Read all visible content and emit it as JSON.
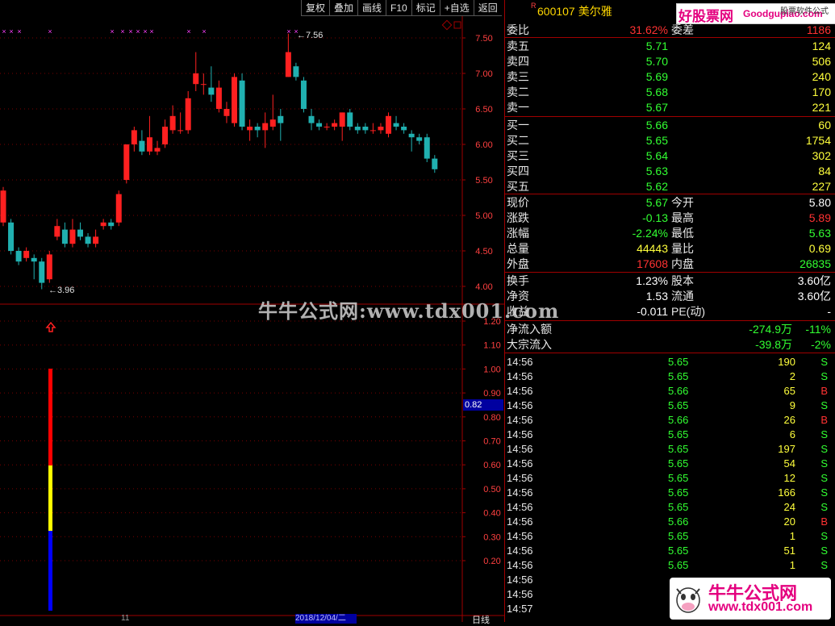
{
  "toolbar": {
    "items": [
      "复权",
      "叠加",
      "画线",
      "F10",
      "标记",
      "+自选",
      "返回"
    ]
  },
  "stock": {
    "flag": "R",
    "code": "600107",
    "name": "美尔雅"
  },
  "logo": {
    "text1": "好股票网",
    "text2": "Goodgupiao.com",
    "text3": "股票软件公式"
  },
  "quote": {
    "weibi_label": "委比",
    "weibi_value": "31.62%",
    "weicha_label": "委差",
    "weicha_value": "1186",
    "sell": [
      {
        "label": "卖五",
        "price": "5.71",
        "vol": "124"
      },
      {
        "label": "卖四",
        "price": "5.70",
        "vol": "506"
      },
      {
        "label": "卖三",
        "price": "5.69",
        "vol": "240"
      },
      {
        "label": "卖二",
        "price": "5.68",
        "vol": "170"
      },
      {
        "label": "卖一",
        "price": "5.67",
        "vol": "221"
      }
    ],
    "buy": [
      {
        "label": "买一",
        "price": "5.66",
        "vol": "60"
      },
      {
        "label": "买二",
        "price": "5.65",
        "vol": "1754"
      },
      {
        "label": "买三",
        "price": "5.64",
        "vol": "302"
      },
      {
        "label": "买四",
        "price": "5.63",
        "vol": "84"
      },
      {
        "label": "买五",
        "price": "5.62",
        "vol": "227"
      }
    ],
    "stats": [
      {
        "l1": "现价",
        "v1": "5.67",
        "l2": "今开",
        "v2": "5.80"
      },
      {
        "l1": "涨跌",
        "v1": "-0.13",
        "l2": "最高",
        "v2": "5.89"
      },
      {
        "l1": "涨幅",
        "v1": "-2.24%",
        "l2": "最低",
        "v2": "5.63"
      },
      {
        "l1": "总量",
        "v1": "44443",
        "l2": "量比",
        "v2": "0.69"
      },
      {
        "l1": "外盘",
        "v1": "17608",
        "l2": "内盘",
        "v2": "26835"
      }
    ],
    "stats2": [
      {
        "l1": "换手",
        "v1": "1.23%",
        "l2": "股本",
        "v2": "3.60亿"
      },
      {
        "l1": "净资",
        "v1": "1.53",
        "l2": "流通",
        "v2": "3.60亿"
      },
      {
        "l1": "收益",
        "v1": "-0.011",
        "l2": "PE(动)",
        "v2": "-"
      }
    ],
    "flow": [
      {
        "l": "净流入额",
        "v": "-274.9万",
        "p": "-11%"
      },
      {
        "l": "大宗流入",
        "v": "-39.8万",
        "p": "-2%"
      }
    ]
  },
  "ticks": [
    {
      "t": "14:56",
      "p": "5.65",
      "v": "190",
      "bs": "S"
    },
    {
      "t": "14:56",
      "p": "5.65",
      "v": "2",
      "bs": "S"
    },
    {
      "t": "14:56",
      "p": "5.66",
      "v": "65",
      "bs": "B"
    },
    {
      "t": "14:56",
      "p": "5.65",
      "v": "9",
      "bs": "S"
    },
    {
      "t": "14:56",
      "p": "5.66",
      "v": "26",
      "bs": "B"
    },
    {
      "t": "14:56",
      "p": "5.65",
      "v": "6",
      "bs": "S"
    },
    {
      "t": "14:56",
      "p": "5.65",
      "v": "197",
      "bs": "S"
    },
    {
      "t": "14:56",
      "p": "5.65",
      "v": "54",
      "bs": "S"
    },
    {
      "t": "14:56",
      "p": "5.65",
      "v": "12",
      "bs": "S"
    },
    {
      "t": "14:56",
      "p": "5.65",
      "v": "166",
      "bs": "S"
    },
    {
      "t": "14:56",
      "p": "5.65",
      "v": "24",
      "bs": "S"
    },
    {
      "t": "14:56",
      "p": "5.66",
      "v": "20",
      "bs": "B"
    },
    {
      "t": "14:56",
      "p": "5.65",
      "v": "1",
      "bs": "S"
    },
    {
      "t": "14:56",
      "p": "5.65",
      "v": "51",
      "bs": "S"
    },
    {
      "t": "14:56",
      "p": "5.65",
      "v": "1",
      "bs": "S"
    },
    {
      "t": "14:56",
      "p": "",
      "v": "",
      "bs": ""
    },
    {
      "t": "14:56",
      "p": "",
      "v": "",
      "bs": ""
    },
    {
      "t": "14:57",
      "p": "",
      "v": "",
      "bs": ""
    }
  ],
  "watermark": {
    "center": "牛牛公式网:www.tdx001.com",
    "corner1": "牛牛公式网",
    "corner2": "www.tdx001.com"
  },
  "chart": {
    "yticks_price": [
      "7.50",
      "7.00",
      "6.50",
      "6.00",
      "5.50",
      "5.00",
      "4.50",
      "4.00"
    ],
    "yticks_ind": [
      "1.20",
      "1.10",
      "1.00",
      "0.90",
      "0.80",
      "0.70",
      "0.60",
      "0.50",
      "0.40",
      "0.30",
      "0.20"
    ],
    "high_label": "7.56",
    "low_label": "3.96",
    "indicator_value": "0.82",
    "date_label": "2018/12/04/二",
    "x_label": "11",
    "period_label": "日线",
    "candles": [
      [
        4.9,
        5.35,
        4.85,
        5.4
      ],
      [
        4.9,
        4.5,
        4.45,
        4.95
      ],
      [
        4.5,
        4.35,
        4.3,
        4.55
      ],
      [
        4.4,
        4.5,
        4.35,
        4.55
      ],
      [
        4.4,
        4.35,
        4.1,
        4.45
      ],
      [
        4.35,
        4.05,
        3.96,
        4.4
      ],
      [
        4.1,
        4.45,
        4.05,
        4.5
      ],
      [
        4.7,
        4.85,
        4.65,
        4.95
      ],
      [
        4.8,
        4.6,
        4.55,
        4.9
      ],
      [
        4.6,
        4.8,
        4.55,
        4.95
      ],
      [
        4.8,
        4.7,
        4.65,
        4.9
      ],
      [
        4.7,
        4.6,
        4.55,
        4.75
      ],
      [
        4.6,
        4.7,
        4.55,
        4.8
      ],
      [
        4.85,
        4.9,
        4.8,
        4.95
      ],
      [
        4.9,
        4.85,
        4.8,
        4.95
      ],
      [
        4.9,
        5.3,
        4.85,
        5.35
      ],
      [
        5.5,
        6.0,
        5.45,
        6.0
      ],
      [
        6.0,
        6.2,
        5.9,
        6.25
      ],
      [
        6.05,
        5.9,
        5.85,
        6.2
      ],
      [
        5.9,
        6.1,
        5.85,
        6.4
      ],
      [
        5.9,
        5.95,
        5.85,
        6.05
      ],
      [
        6.0,
        6.25,
        5.95,
        6.35
      ],
      [
        6.2,
        6.4,
        6.15,
        6.55
      ],
      [
        6.2,
        6.2,
        6.15,
        6.45
      ],
      [
        6.2,
        6.65,
        6.15,
        6.75
      ],
      [
        6.85,
        7.0,
        6.75,
        7.3
      ],
      [
        6.85,
        6.85,
        6.7,
        7.0
      ],
      [
        6.8,
        6.7,
        6.6,
        7.1
      ],
      [
        6.5,
        6.8,
        6.45,
        6.9
      ],
      [
        6.4,
        6.5,
        6.3,
        6.6
      ],
      [
        6.3,
        6.95,
        6.25,
        7.0
      ],
      [
        6.9,
        6.25,
        6.2,
        7.0
      ],
      [
        6.2,
        6.25,
        6.05,
        6.35
      ],
      [
        6.25,
        6.2,
        6.1,
        6.3
      ],
      [
        6.2,
        6.3,
        5.95,
        6.45
      ],
      [
        6.25,
        6.35,
        6.2,
        6.7
      ],
      [
        6.4,
        6.3,
        6.05,
        6.5
      ],
      [
        6.95,
        7.3,
        6.95,
        7.56
      ],
      [
        7.1,
        6.95,
        6.9,
        7.15
      ],
      [
        6.9,
        6.5,
        6.45,
        6.95
      ],
      [
        6.4,
        6.3,
        6.2,
        6.5
      ],
      [
        6.3,
        6.25,
        6.2,
        6.35
      ],
      [
        6.25,
        6.25,
        6.2,
        6.3
      ],
      [
        6.25,
        6.3,
        6.2,
        6.35
      ],
      [
        6.25,
        6.45,
        6.05,
        6.45
      ],
      [
        6.45,
        6.25,
        6.2,
        6.5
      ],
      [
        6.25,
        6.2,
        6.15,
        6.3
      ],
      [
        6.25,
        6.2,
        6.15,
        6.3
      ],
      [
        6.2,
        6.2,
        6.15,
        6.3
      ],
      [
        6.2,
        6.25,
        6.15,
        6.3
      ],
      [
        6.15,
        6.4,
        6.1,
        6.45
      ],
      [
        6.3,
        6.25,
        6.2,
        6.4
      ],
      [
        6.25,
        6.2,
        6.15,
        6.3
      ],
      [
        6.15,
        6.1,
        5.9,
        6.2
      ],
      [
        6.1,
        6.05,
        6.0,
        6.15
      ],
      [
        6.1,
        5.8,
        5.75,
        6.15
      ],
      [
        5.8,
        5.65,
        5.6,
        5.85
      ]
    ],
    "indicator_bars": [
      {
        "color": "#ff0000",
        "from": 1.0,
        "to": 0.6
      },
      {
        "color": "#ffff00",
        "from": 0.6,
        "to": 0.33
      },
      {
        "color": "#0000ff",
        "from": 0.33,
        "to": 0.0
      }
    ]
  }
}
